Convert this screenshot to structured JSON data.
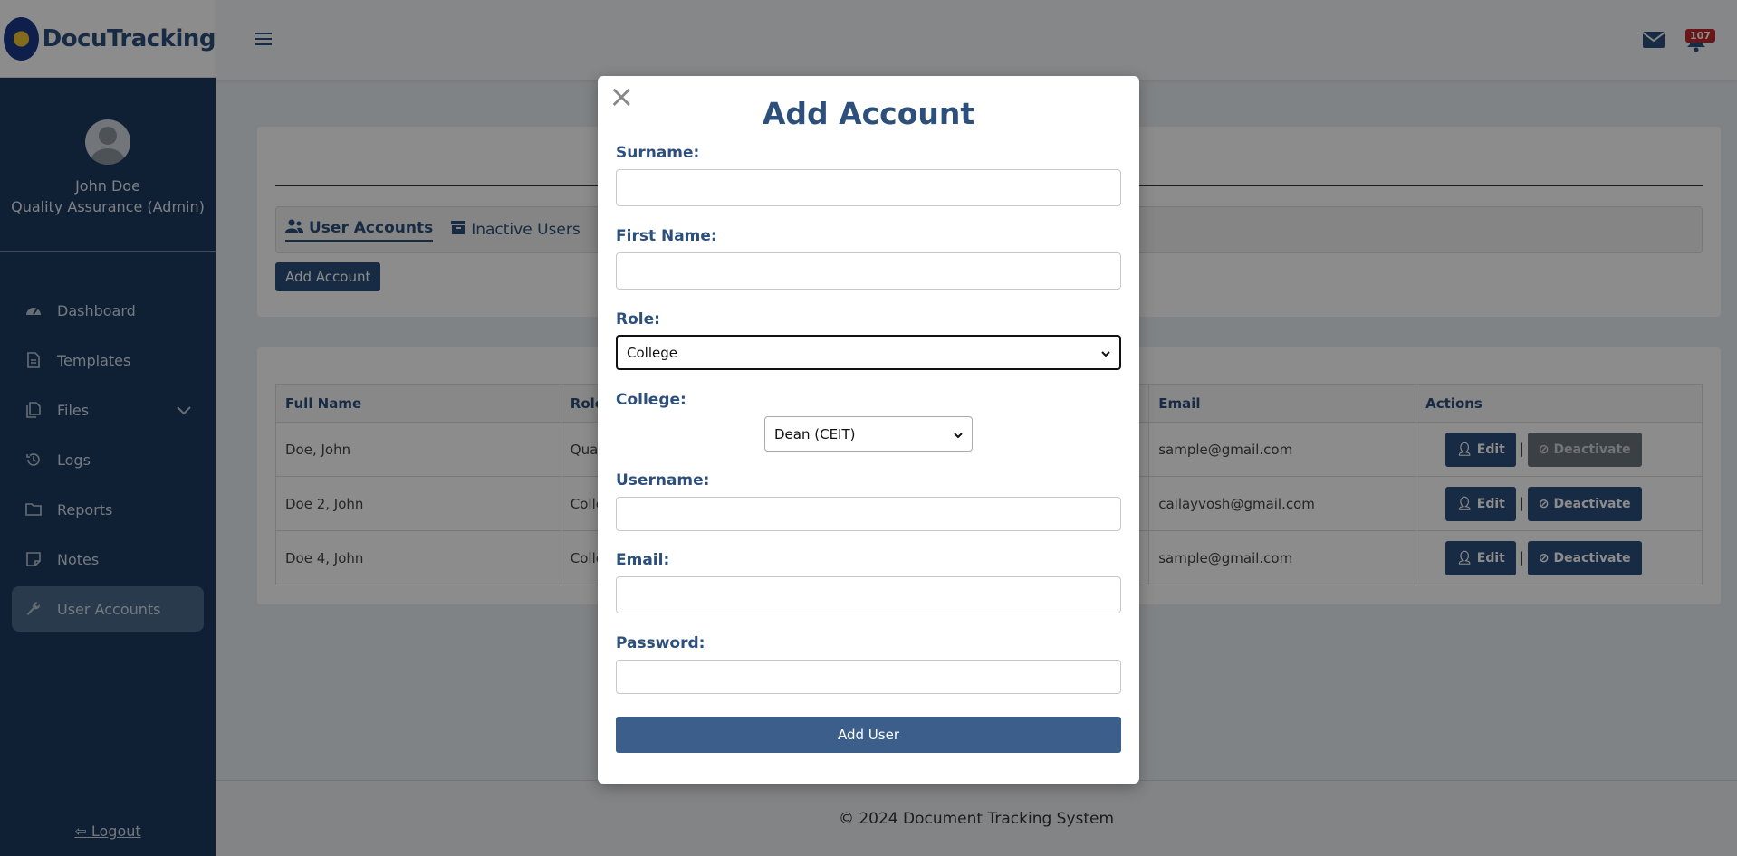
{
  "brand": {
    "name": "DocuTracking"
  },
  "user": {
    "name": "John Doe",
    "role": "Quality Assurance (Admin)"
  },
  "nav": [
    {
      "label": "Dashboard",
      "icon": "dashboard-icon"
    },
    {
      "label": "Templates",
      "icon": "file-icon"
    },
    {
      "label": "Files",
      "icon": "files-icon"
    },
    {
      "label": "Logs",
      "icon": "history-icon"
    },
    {
      "label": "Reports",
      "icon": "folder-icon"
    },
    {
      "label": "Notes",
      "icon": "note-icon"
    },
    {
      "label": "User Accounts",
      "icon": "wrench-icon",
      "active": true
    }
  ],
  "logout_label": "Logout",
  "topbar": {
    "notification_count": "107"
  },
  "tabs": [
    {
      "label": "User Accounts",
      "active": true
    },
    {
      "label": "Inactive Users",
      "active": false
    }
  ],
  "add_account_button": "Add Account",
  "table": {
    "headers": [
      "Full Name",
      "Role",
      "Email",
      "Actions"
    ],
    "rows": [
      {
        "name": "Doe, John",
        "role": "Qua",
        "email": "sample@gmail.com",
        "deactivate_disabled": true
      },
      {
        "name": "Doe 2, John",
        "role": "Colle",
        "email": "cailayvosh@gmail.com",
        "deactivate_disabled": false
      },
      {
        "name": "Doe 4, John",
        "role": "Colle",
        "email": "sample@gmail.com",
        "deactivate_disabled": false
      }
    ],
    "edit_label": "Edit",
    "deactivate_label": "Deactivate",
    "separator": "|"
  },
  "footer": "© 2024 Document Tracking System",
  "modal": {
    "close": "×",
    "title": "Add Account",
    "surname_label": "Surname:",
    "first_name_label": "First Name:",
    "role_label": "Role:",
    "role_value": "College",
    "college_label": "College:",
    "college_value": "Dean (CEIT)",
    "username_label": "Username:",
    "email_label": "Email:",
    "password_label": "Password:",
    "submit_label": "Add User"
  },
  "colors": {
    "primary": "#2c4f7c",
    "sidebar": "#1d3a5f",
    "badge": "#c1272d"
  }
}
